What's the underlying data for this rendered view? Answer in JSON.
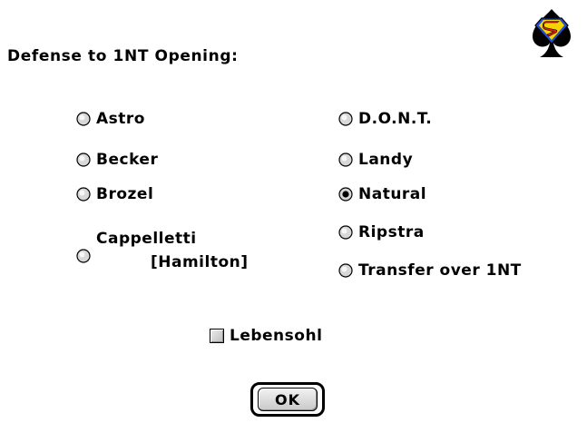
{
  "dialog": {
    "title": "Defense to 1NT Opening:",
    "logo_icon": "superman-spade-icon",
    "left_options": [
      {
        "label": "Astro",
        "selected": false
      },
      {
        "label": "Becker",
        "selected": false
      },
      {
        "label": "Brozel",
        "selected": false
      },
      {
        "label_line1": "Cappelletti",
        "label_line2": "[Hamilton]",
        "selected": false
      }
    ],
    "right_options": [
      {
        "label": "D.O.N.T.",
        "selected": false
      },
      {
        "label": "Landy",
        "selected": false
      },
      {
        "label": "Natural",
        "selected": true
      },
      {
        "label": "Ripstra",
        "selected": false
      },
      {
        "label": "Transfer over 1NT",
        "selected": false
      }
    ],
    "checkbox": {
      "label": "Lebensohl",
      "checked": false
    },
    "ok_label": "OK"
  },
  "colors": {
    "background": "#ffffff",
    "text": "#000000",
    "logo_red": "#e01b1b",
    "logo_yellow": "#f5d400",
    "logo_blue": "#1f4fd8"
  }
}
